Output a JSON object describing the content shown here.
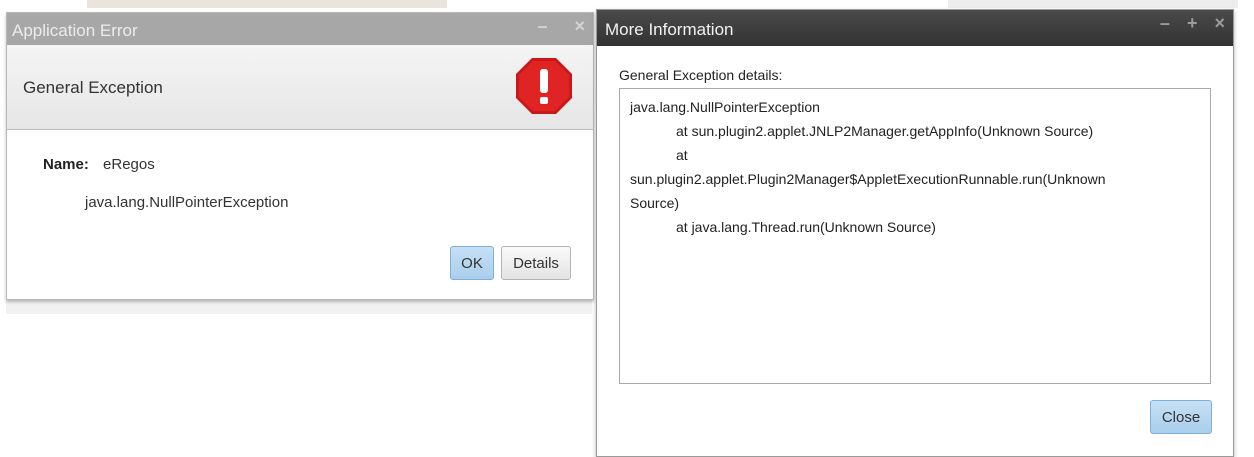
{
  "app_error": {
    "window_title": "Application Error",
    "window_controls": [
      "–",
      "×"
    ],
    "header_title": "General Exception",
    "name_label": "Name:",
    "name_value": "eRegos",
    "exception": "java.lang.NullPointerException",
    "buttons": {
      "ok": "OK",
      "details": "Details"
    }
  },
  "more_info": {
    "window_title": "More Information",
    "window_controls": [
      "–",
      "+",
      "×"
    ],
    "details_label": "General Exception details:",
    "details_lines": [
      "java.lang.NullPointerException",
      "at sun.plugin2.applet.JNLP2Manager.getAppInfo(Unknown Source)",
      "at",
      "sun.plugin2.applet.Plugin2Manager$AppletExecutionRunnable.run(Unknown",
      "Source)",
      "at java.lang.Thread.run(Unknown Source)"
    ],
    "close_label": "Close"
  },
  "icons": {
    "error": "stop-error-icon"
  },
  "colors": {
    "error_title_bar": "#a7a7a7",
    "info_title_bar": "#3a3a3a",
    "stop_icon": "#d81e1e",
    "primary_button": "#b7d7f0"
  }
}
